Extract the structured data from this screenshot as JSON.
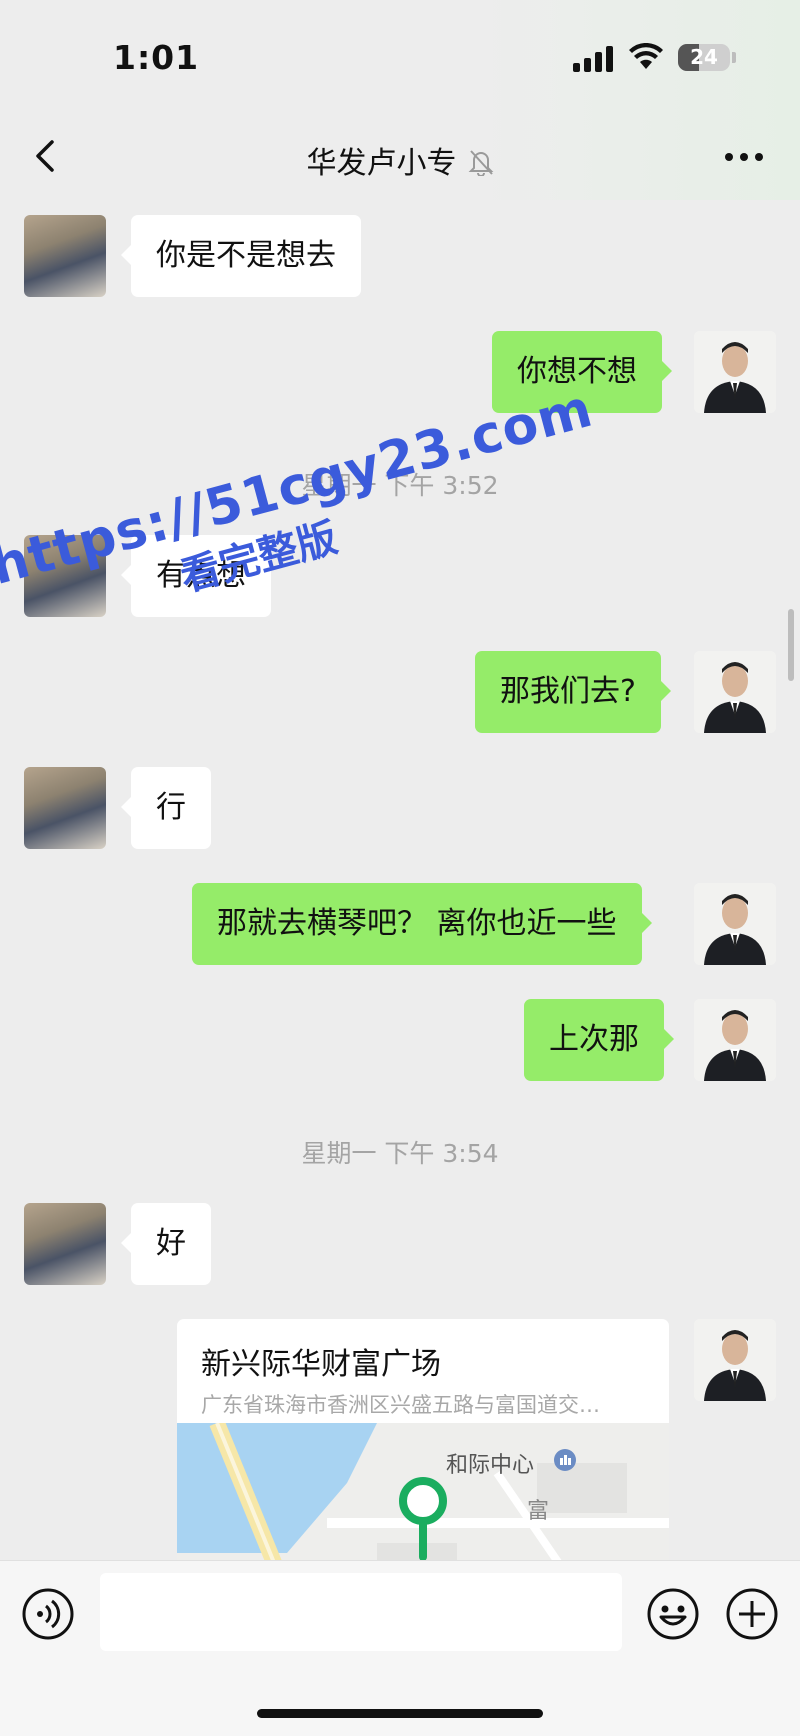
{
  "status_bar": {
    "time": "1:01",
    "battery": "24",
    "battery_level": 0.24
  },
  "nav": {
    "title": "华发卢小专",
    "back_icon": "chevron-left-icon",
    "mute_icon": "bell-off-icon",
    "more_icon": "more-icon"
  },
  "watermark": {
    "line1": "https://51cgy23.com",
    "line2": "看完整版"
  },
  "messages": [
    {
      "from": "her",
      "text": "你是不是想去"
    },
    {
      "from": "me",
      "text": "你想不想"
    },
    {
      "type": "time",
      "text": "星期一 下午 3:52"
    },
    {
      "from": "her",
      "text": "有点想"
    },
    {
      "from": "me",
      "text": "那我们去?"
    },
    {
      "from": "her",
      "text": "行"
    },
    {
      "from": "me",
      "text": "那就去横琴吧？ 离你也近一些"
    },
    {
      "from": "me",
      "text": "上次那"
    },
    {
      "type": "time",
      "text": "星期一 下午 3:54"
    },
    {
      "from": "her",
      "text": "好"
    }
  ],
  "location": {
    "name": "新兴际华财富广场",
    "address": "广东省珠海市香洲区兴盛五路与富国道交…",
    "map_poi": "和际中心",
    "map_road_char": "富"
  },
  "input": {
    "voice_icon": "voice-icon",
    "emoji_icon": "emoji-icon",
    "plus_icon": "plus-icon",
    "placeholder": ""
  },
  "colors": {
    "background": "#ededed",
    "outgoing_bubble": "#95ec69",
    "incoming_bubble": "#ffffff",
    "map_pin": "#1aad5f",
    "watermark": "#3b5bdb"
  }
}
